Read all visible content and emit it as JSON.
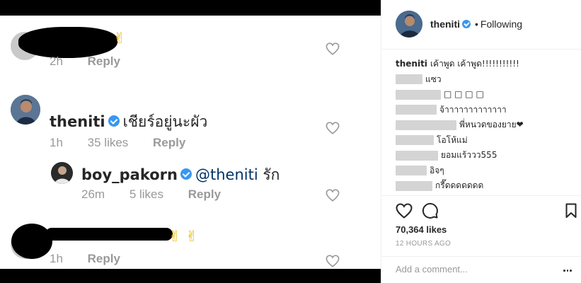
{
  "photo": {
    "comments": [
      {
        "meta": {
          "time": "2h",
          "reply": "Reply"
        },
        "emoji": "✌"
      },
      {
        "username": "theniti",
        "text": "เชียร์อยู่นะผัว",
        "meta": {
          "time": "1h",
          "likes": "35 likes",
          "reply": "Reply"
        }
      },
      {
        "username": "boy_pakorn",
        "mention": "@theniti",
        "text": "รัก",
        "meta": {
          "time": "26m",
          "likes": "5 likes",
          "reply": "Reply"
        }
      },
      {
        "meta": {
          "time": "1h",
          "reply": "Reply"
        },
        "emoji": "✌ ✌"
      }
    ]
  },
  "header": {
    "username": "theniti",
    "separator": "•",
    "follow_status": "Following"
  },
  "caption": {
    "username": "theniti",
    "text": "เค้าพูด เค้าพูด!!!!!!!!!!!"
  },
  "side_comments": [
    {
      "text": "แซว"
    },
    {
      "text": "□ □ □ □"
    },
    {
      "text": "จ้าาาาาาาาาาาาา"
    },
    {
      "text": "พี่หนวดของยาย❤"
    },
    {
      "text": "โอโห้แม่"
    },
    {
      "text": "ยอมแร้ววว555"
    },
    {
      "text": "อิจๆ"
    },
    {
      "text": "กรี๊ดดดดดดด"
    }
  ],
  "actions": {
    "likes": "70,364 likes",
    "time": "12 HOURS AGO"
  },
  "add_comment": {
    "placeholder": "Add a comment..."
  },
  "colors": {
    "verified": "#3897f0",
    "muted": "#999999",
    "border": "#efefef"
  },
  "icons": [
    "heart-icon",
    "comment-icon",
    "bookmark-icon",
    "verified-icon",
    "more-icon"
  ]
}
